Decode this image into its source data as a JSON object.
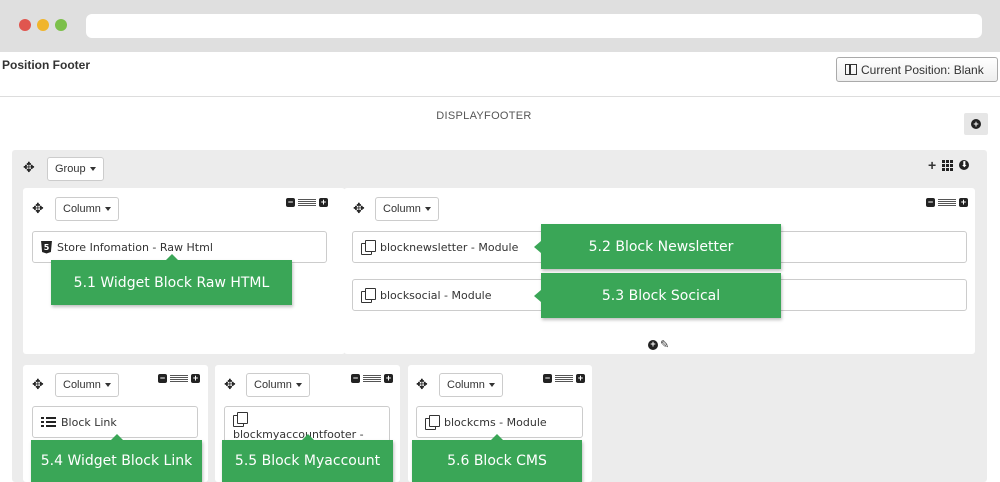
{
  "header": {
    "title": "Position Footer",
    "current_position_label": "Current Position: Blank"
  },
  "hook": {
    "name": "DISPLAYFOOTER"
  },
  "group": {
    "label": "Group"
  },
  "columns": [
    {
      "label": "Column",
      "modules": [
        {
          "text": "Store Infomation - Raw Html",
          "icon": "html5-icon"
        }
      ]
    },
    {
      "label": "Column",
      "modules": [
        {
          "text": "blocknewsletter - Module",
          "icon": "module-icon"
        },
        {
          "text": "blocksocial - Module",
          "icon": "module-icon"
        }
      ]
    },
    {
      "label": "Column",
      "modules": [
        {
          "text": "Block Link",
          "icon": "list-icon"
        }
      ]
    },
    {
      "label": "Column",
      "modules": [
        {
          "text": "blockmyaccountfooter -",
          "icon": "module-icon"
        }
      ]
    },
    {
      "label": "Column",
      "modules": [
        {
          "text": "blockcms - Module",
          "icon": "module-icon"
        }
      ]
    }
  ],
  "callouts": {
    "c51": "5.1  Widget Block Raw HTML",
    "c52": "5.2  Block Newsletter",
    "c53": "5.3  Block Socical",
    "c54": "5.4  Widget Block Link",
    "c55": "5.5 Block Myaccount",
    "c56": "5.6  Block CMS"
  },
  "colors": {
    "callout_green": "#3aa657",
    "group_bg": "#ececec",
    "chrome_bg": "#dfdfdf"
  }
}
